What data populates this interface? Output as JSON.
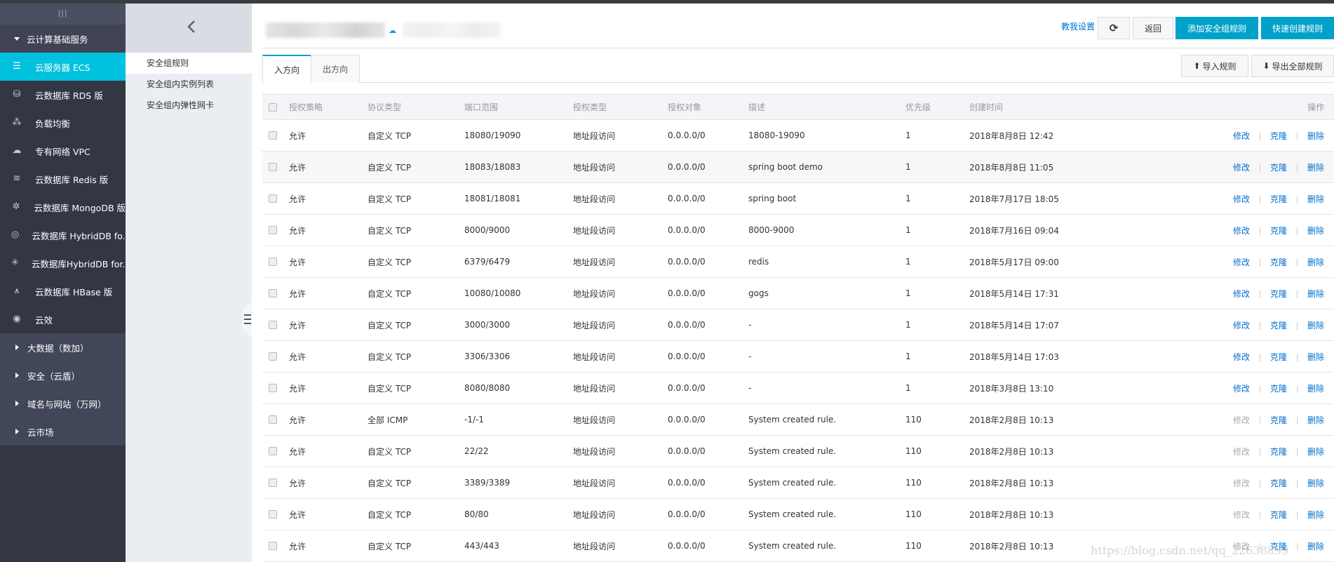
{
  "sidebar": {
    "section": "云计算基础服务",
    "items": [
      {
        "label": "云服务器 ECS",
        "icon": "server-icon",
        "active": true
      },
      {
        "label": "云数据库 RDS 版",
        "icon": "database-icon"
      },
      {
        "label": "负载均衡",
        "icon": "load-balancer-icon"
      },
      {
        "label": "专有网络 VPC",
        "icon": "cloud-network-icon"
      },
      {
        "label": "云数据库 Redis 版",
        "icon": "redis-icon"
      },
      {
        "label": "云数据库 MongoDB 版",
        "icon": "mongodb-icon"
      },
      {
        "label": "云数据库 HybridDB fo...",
        "icon": "hybriddb-icon"
      },
      {
        "label": "云数据库HybridDB for...",
        "icon": "hybriddb-network-icon"
      },
      {
        "label": "云数据库 HBase 版",
        "icon": "hbase-icon"
      },
      {
        "label": "云效",
        "icon": "eye-icon"
      }
    ],
    "groups": [
      "大数据（数加）",
      "安全（云盾）",
      "域名与网站（万网）",
      "云市场"
    ]
  },
  "subnav": {
    "items": [
      "安全组规则",
      "安全组内实例列表",
      "安全组内弹性网卡"
    ]
  },
  "header": {
    "help_link": "教我设置",
    "back": "返回",
    "add_rule": "添加安全组规则",
    "quick_create": "快速创建规则"
  },
  "tabs": [
    "入方向",
    "出方向"
  ],
  "toolbar": {
    "import": "导入规则",
    "export": "导出全部规则"
  },
  "table": {
    "columns": [
      "授权策略",
      "协议类型",
      "端口范围",
      "授权类型",
      "授权对象",
      "描述",
      "优先级",
      "创建时间",
      "操作"
    ],
    "actions": [
      "修改",
      "克隆",
      "删除"
    ],
    "rows": [
      [
        "允许",
        "自定义 TCP",
        "18080/19090",
        "地址段访问",
        "0.0.0.0/0",
        "18080-19090",
        "1",
        "2018年8月8日 12:42"
      ],
      [
        "允许",
        "自定义 TCP",
        "18083/18083",
        "地址段访问",
        "0.0.0.0/0",
        "spring boot demo",
        "1",
        "2018年8月8日 11:05"
      ],
      [
        "允许",
        "自定义 TCP",
        "18081/18081",
        "地址段访问",
        "0.0.0.0/0",
        "spring boot",
        "1",
        "2018年7月17日 18:05"
      ],
      [
        "允许",
        "自定义 TCP",
        "8000/9000",
        "地址段访问",
        "0.0.0.0/0",
        "8000-9000",
        "1",
        "2018年7月16日 09:04"
      ],
      [
        "允许",
        "自定义 TCP",
        "6379/6479",
        "地址段访问",
        "0.0.0.0/0",
        "redis",
        "1",
        "2018年5月17日 09:00"
      ],
      [
        "允许",
        "自定义 TCP",
        "10080/10080",
        "地址段访问",
        "0.0.0.0/0",
        "gogs",
        "1",
        "2018年5月14日 17:31"
      ],
      [
        "允许",
        "自定义 TCP",
        "3000/3000",
        "地址段访问",
        "0.0.0.0/0",
        "-",
        "1",
        "2018年5月14日 17:07"
      ],
      [
        "允许",
        "自定义 TCP",
        "3306/3306",
        "地址段访问",
        "0.0.0.0/0",
        "-",
        "1",
        "2018年5月14日 17:03"
      ],
      [
        "允许",
        "自定义 TCP",
        "8080/8080",
        "地址段访问",
        "0.0.0.0/0",
        "-",
        "1",
        "2018年3月8日 13:10"
      ],
      [
        "允许",
        "全部 ICMP",
        "-1/-1",
        "地址段访问",
        "0.0.0.0/0",
        "System created rule.",
        "110",
        "2018年2月8日 10:13"
      ],
      [
        "允许",
        "自定义 TCP",
        "22/22",
        "地址段访问",
        "0.0.0.0/0",
        "System created rule.",
        "110",
        "2018年2月8日 10:13"
      ],
      [
        "允许",
        "自定义 TCP",
        "3389/3389",
        "地址段访问",
        "0.0.0.0/0",
        "System created rule.",
        "110",
        "2018年2月8日 10:13"
      ],
      [
        "允许",
        "自定义 TCP",
        "80/80",
        "地址段访问",
        "0.0.0.0/0",
        "System created rule.",
        "110",
        "2018年2月8日 10:13"
      ],
      [
        "允许",
        "自定义 TCP",
        "443/443",
        "地址段访问",
        "0.0.0.0/0",
        "System created rule.",
        "110",
        "2018年2月8日 10:13"
      ]
    ],
    "edit_disabled_from_row": 9,
    "hover_row": 1
  },
  "watermark": "https://blog.csdn.net/qq_22638899",
  "colors": {
    "accent": "#00c1de",
    "primary_button": "#00a2ca",
    "link": "#0070cc",
    "sidebar": "#333744"
  }
}
